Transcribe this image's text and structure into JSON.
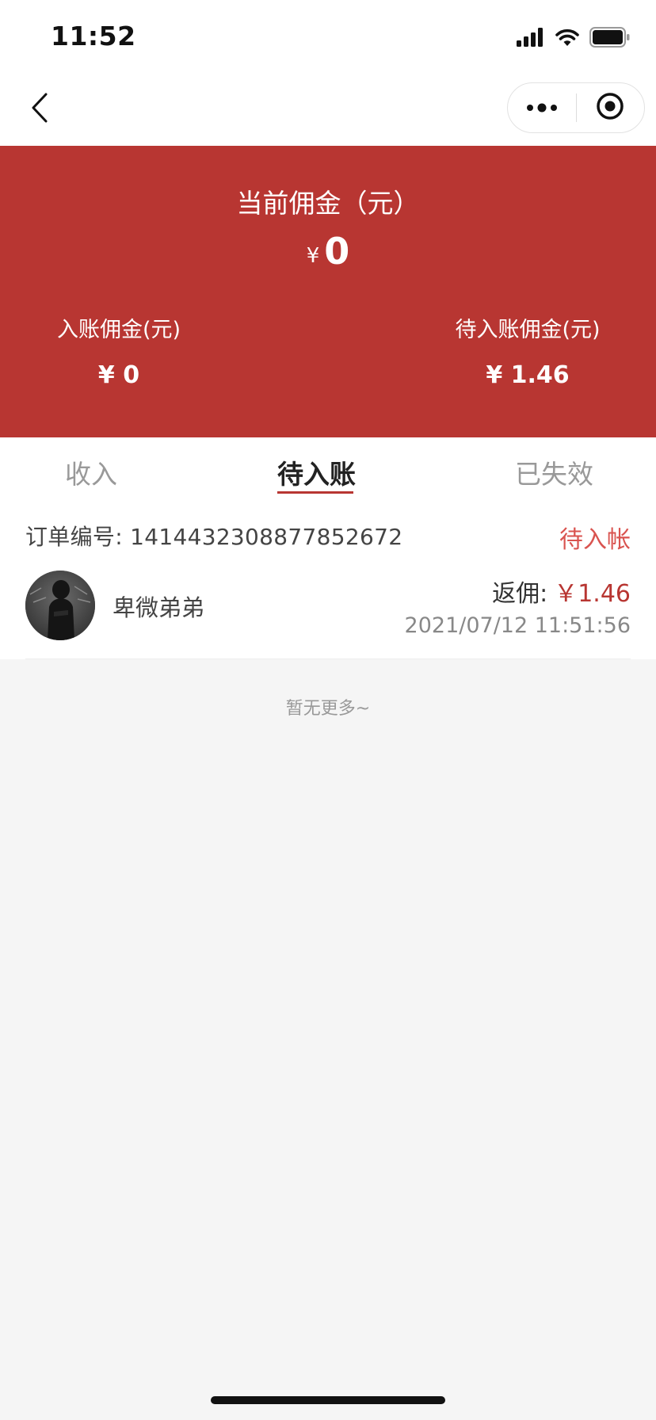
{
  "status_bar": {
    "time": "11:52",
    "icons": [
      "cellular-signal-icon",
      "wifi-icon",
      "battery-icon"
    ]
  },
  "nav": {
    "back_icon": "chevron-left-icon",
    "more_icon": "more-dots-icon",
    "close_icon": "target-circle-icon"
  },
  "summary": {
    "title": "当前佣金（元）",
    "current_symbol": "¥",
    "current_value": "0",
    "settled_label": "入账佣金(元)",
    "settled_value": "¥ 0",
    "pending_label": "待入账佣金(元)",
    "pending_value": "¥ 1.46",
    "background_color": "#b83632"
  },
  "tabs": [
    {
      "label": "收入",
      "active": false
    },
    {
      "label": "待入账",
      "active": true
    },
    {
      "label": "已失效",
      "active": false
    }
  ],
  "order": {
    "number_label": "订单编号: 1414432308877852672",
    "status": "待入帐",
    "user_name": "卑微弟弟",
    "rebate_label": "返佣:",
    "rebate_amount": "￥1.46",
    "time": "2021/07/12 11:51:56"
  },
  "footer": {
    "no_more": "暂无更多~"
  },
  "colors": {
    "accent": "#b83632",
    "status_pending": "#d9534f",
    "page_background": "#f5f5f5"
  }
}
